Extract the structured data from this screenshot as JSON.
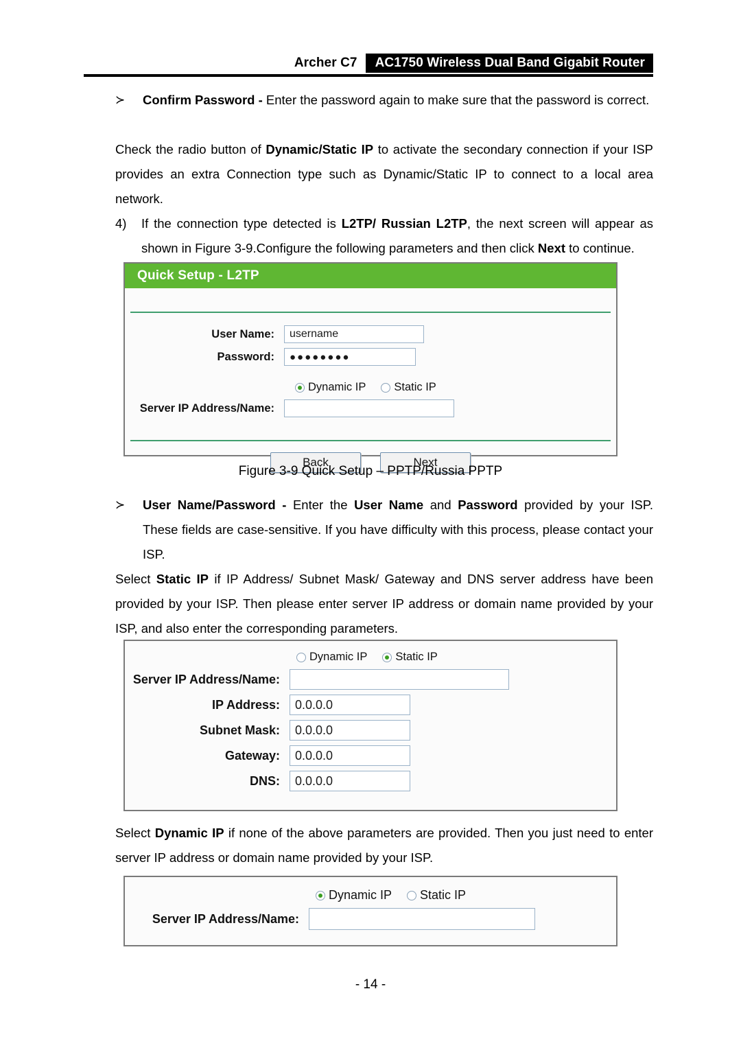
{
  "header": {
    "model": "Archer C7",
    "product": "AC1750 Wireless Dual Band Gigabit Router"
  },
  "content": {
    "bullet_mark": "≻",
    "confirm_password_bullet": {
      "term": "Confirm Password -",
      "body": " Enter the password again to make sure that the password is correct."
    },
    "paragraph_dynamic_static": {
      "part1": "Check the radio button of ",
      "bold1": "Dynamic/Static IP",
      "part2": " to activate the secondary connection if your ISP provides an extra Connection type such as Dynamic/Static IP to connect to a local area network."
    },
    "step4": {
      "number": "4)",
      "part1": "If the connection type detected is ",
      "bold1": "L2TP/ Russian L2TP",
      "part2": ", the next screen will appear as shown in Figure 3-9.Configure the following parameters and then click ",
      "bold2": "Next",
      "part3": " to continue."
    },
    "figure_caption": "Figure 3-9 Quick Setup – PPTP/Russia PPTP",
    "username_password_bullet": {
      "term": "User Name/Password -",
      "part1": " Enter the ",
      "bold1": "User Name",
      "part2": " and ",
      "bold2": "Password",
      "part3": " provided by your ISP. These fields are case-sensitive. If you have difficulty with this process, please contact your ISP."
    },
    "paragraph_static_ip": {
      "part1": "Select ",
      "bold1": "Static IP",
      "part2": " if IP Address/ Subnet Mask/ Gateway and DNS server address have been provided by your ISP. Then please enter server IP address or domain name provided by your ISP, and also enter the corresponding parameters."
    },
    "paragraph_dynamic_ip": {
      "part1": "Select ",
      "bold1": "Dynamic IP",
      "part2": " if none of the above parameters are provided. Then you just need to enter server IP address or domain name provided by your ISP."
    }
  },
  "figure1": {
    "title": "Quick Setup - L2TP",
    "fields": {
      "username_label": "User Name:",
      "username_value": "username",
      "password_label": "Password:",
      "password_value": "●●●●●●●●",
      "server_label": "Server IP Address/Name:",
      "server_value": ""
    },
    "radios": {
      "dynamic_label": "Dynamic IP",
      "static_label": "Static IP",
      "selected": "dynamic"
    },
    "buttons": {
      "back": "Back",
      "next": "Next"
    }
  },
  "figure2": {
    "radios": {
      "dynamic_label": "Dynamic IP",
      "static_label": "Static IP",
      "selected": "static"
    },
    "fields": [
      {
        "label": "Server IP Address/Name:",
        "value": ""
      },
      {
        "label": "IP Address:",
        "value": "0.0.0.0"
      },
      {
        "label": "Subnet Mask:",
        "value": "0.0.0.0"
      },
      {
        "label": "Gateway:",
        "value": "0.0.0.0"
      },
      {
        "label": "DNS:",
        "value": "0.0.0.0"
      }
    ]
  },
  "figure3": {
    "radios": {
      "dynamic_label": "Dynamic IP",
      "static_label": "Static IP",
      "selected": "dynamic"
    },
    "fields": {
      "server_label": "Server IP Address/Name:",
      "server_value": ""
    }
  },
  "footer": {
    "page_number": "- 14 -"
  },
  "colors": {
    "accent_green": "#5fb733",
    "divider_green": "#3f9e6e",
    "radio_dot": "#3a9e22",
    "header_band": "#000000"
  }
}
